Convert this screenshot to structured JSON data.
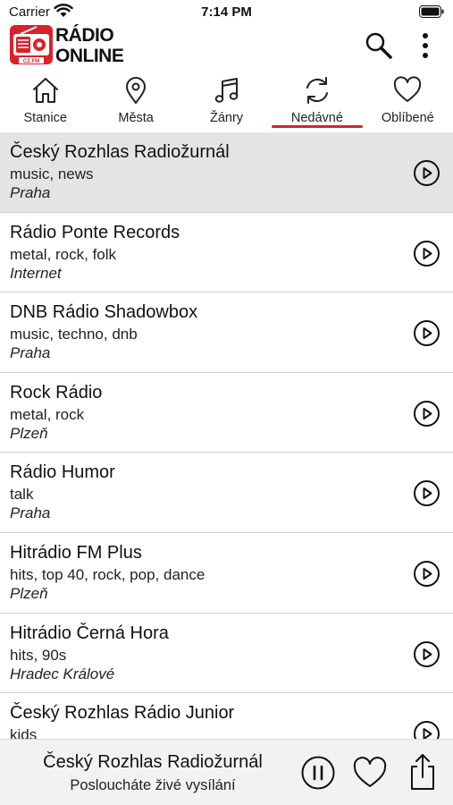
{
  "status_bar": {
    "carrier": "Carrier",
    "time": "7:14 PM",
    "wifi_icon": "wifi-icon",
    "battery_icon": "battery-icon"
  },
  "header": {
    "logo_icon": "radio-logo-icon",
    "logo_badge": "CZ.FM",
    "logo_line1": "RÁDIO",
    "logo_line2": "ONLINE",
    "search_icon": "search-icon",
    "menu_icon": "more-vertical-icon",
    "brand_color": "#d8232a"
  },
  "tabs": [
    {
      "label": "Stanice",
      "icon": "home-icon",
      "active": false
    },
    {
      "label": "Města",
      "icon": "location-pin-icon",
      "active": false
    },
    {
      "label": "Žánry",
      "icon": "music-note-icon",
      "active": false
    },
    {
      "label": "Nedávné",
      "icon": "refresh-icon",
      "active": true
    },
    {
      "label": "Oblíbené",
      "icon": "heart-icon",
      "active": false
    }
  ],
  "stations": [
    {
      "name": "Český Rozhlas Radiožurnál",
      "genres": "music, news",
      "city": "Praha",
      "selected": true
    },
    {
      "name": "Rádio Ponte Records",
      "genres": "metal, rock, folk",
      "city": "Internet",
      "selected": false
    },
    {
      "name": "DNB Rádio Shadowbox",
      "genres": "music, techno, dnb",
      "city": "Praha",
      "selected": false
    },
    {
      "name": "Rock Rádio",
      "genres": "metal, rock",
      "city": "Plzeň",
      "selected": false
    },
    {
      "name": "Rádio Humor",
      "genres": "talk",
      "city": "Praha",
      "selected": false
    },
    {
      "name": "Hitrádio FM Plus",
      "genres": "hits, top 40, rock, pop, dance",
      "city": "Plzeň",
      "selected": false
    },
    {
      "name": "Hitrádio Černá Hora",
      "genres": "hits, 90s",
      "city": "Hradec Králové",
      "selected": false
    },
    {
      "name": "Český Rozhlas Rádio Junior",
      "genres": "kids",
      "city": "",
      "selected": false
    }
  ],
  "player": {
    "title": "Český Rozhlas Radiožurnál",
    "subtitle": "Posloucháte živé vysílání",
    "pause_icon": "pause-circle-icon",
    "favorite_icon": "heart-icon",
    "share_icon": "share-icon"
  },
  "colors": {
    "accent": "#d8232a",
    "selected_row": "#e4e4e4",
    "player_bg": "#f2f2f2"
  }
}
